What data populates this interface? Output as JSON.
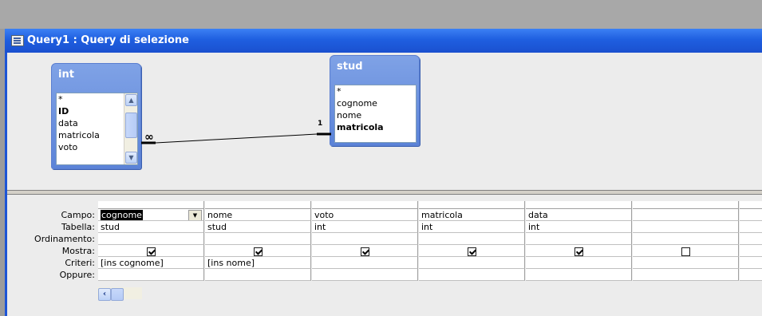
{
  "window": {
    "title": "Query1 : Query di selezione"
  },
  "tables": [
    {
      "name": "int",
      "fields": [
        "*",
        "ID",
        "data",
        "matricola",
        "voto"
      ],
      "bold_fields": [
        "ID"
      ]
    },
    {
      "name": "stud",
      "fields": [
        "*",
        "cognome",
        "nome",
        "matricola"
      ],
      "bold_fields": [
        "matricola"
      ]
    }
  ],
  "join": {
    "left_label": "∞",
    "right_label": "1"
  },
  "row_labels": {
    "campo": "Campo:",
    "tabella": "Tabella:",
    "ordinamento": "Ordinamento:",
    "mostra": "Mostra:",
    "criteri": "Criteri:",
    "oppure": "Oppure:"
  },
  "columns": [
    {
      "campo": "cognome",
      "tabella": "stud",
      "mostra": true,
      "criteri": "[ins cognome]"
    },
    {
      "campo": "nome",
      "tabella": "stud",
      "mostra": true,
      "criteri": "[ins nome]"
    },
    {
      "campo": "voto",
      "tabella": "int",
      "mostra": true,
      "criteri": ""
    },
    {
      "campo": "matricola",
      "tabella": "int",
      "mostra": true,
      "criteri": ""
    },
    {
      "campo": "data",
      "tabella": "int",
      "mostra": true,
      "criteri": ""
    },
    {
      "campo": "",
      "tabella": "",
      "mostra": false,
      "criteri": ""
    }
  ]
}
